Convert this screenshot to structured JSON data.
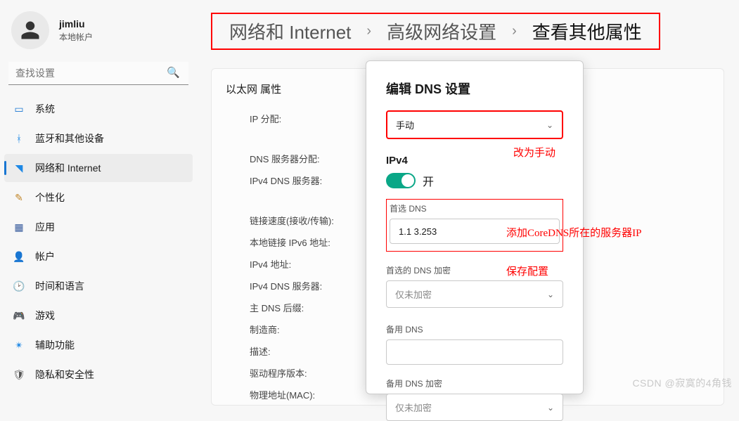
{
  "user": {
    "name": "jimliu",
    "account_type": "本地帐户"
  },
  "search": {
    "placeholder": "查找设置"
  },
  "sidebar": {
    "items": [
      {
        "label": "系统",
        "icon_color": "#1976d2"
      },
      {
        "label": "蓝牙和其他设备",
        "icon_color": "#1e88e5"
      },
      {
        "label": "网络和 Internet",
        "icon_color": "#1e88e5"
      },
      {
        "label": "个性化",
        "icon_color": "#c18426"
      },
      {
        "label": "应用",
        "icon_color": "#365a9c"
      },
      {
        "label": "帐户",
        "icon_color": "#2e9a6e"
      },
      {
        "label": "时间和语言",
        "icon_color": "#555"
      },
      {
        "label": "游戏",
        "icon_color": "#7a3d8c"
      },
      {
        "label": "辅助功能",
        "icon_color": "#1e88e5"
      },
      {
        "label": "隐私和安全性",
        "icon_color": "#555"
      }
    ]
  },
  "breadcrumb": {
    "a": "网络和 Internet",
    "b": "高级网络设置",
    "c": "查看其他属性"
  },
  "panel": {
    "title": "以太网 属性",
    "props": [
      "IP 分配:",
      "",
      "DNS 服务器分配:",
      "IPv4 DNS 服务器:",
      "",
      "链接速度(接收/传输):",
      "本地链接 IPv6 地址:",
      "IPv4 地址:",
      "IPv4 DNS 服务器:",
      "主 DNS 后缀:",
      "制造商:",
      "描述:",
      "驱动程序版本:",
      "物理地址(MAC):"
    ]
  },
  "dialog": {
    "title": "编辑 DNS 设置",
    "mode_value": "手动",
    "ipv4_label": "IPv4",
    "toggle_state": "开",
    "preferred_dns_label": "首选 DNS",
    "preferred_dns_value": "1.1    3.253",
    "preferred_enc_label": "首选的 DNS 加密",
    "preferred_enc_value": "仅未加密",
    "alt_dns_label": "备用 DNS",
    "alt_dns_value": "",
    "alt_enc_label": "备用 DNS 加密",
    "alt_enc_value": "仅未加密"
  },
  "annotations": {
    "a1": "改为手动",
    "a2": "添加CoreDNS所在的服务器IP",
    "a3": "保存配置"
  },
  "watermark": "CSDN @寂寞的4角钱"
}
